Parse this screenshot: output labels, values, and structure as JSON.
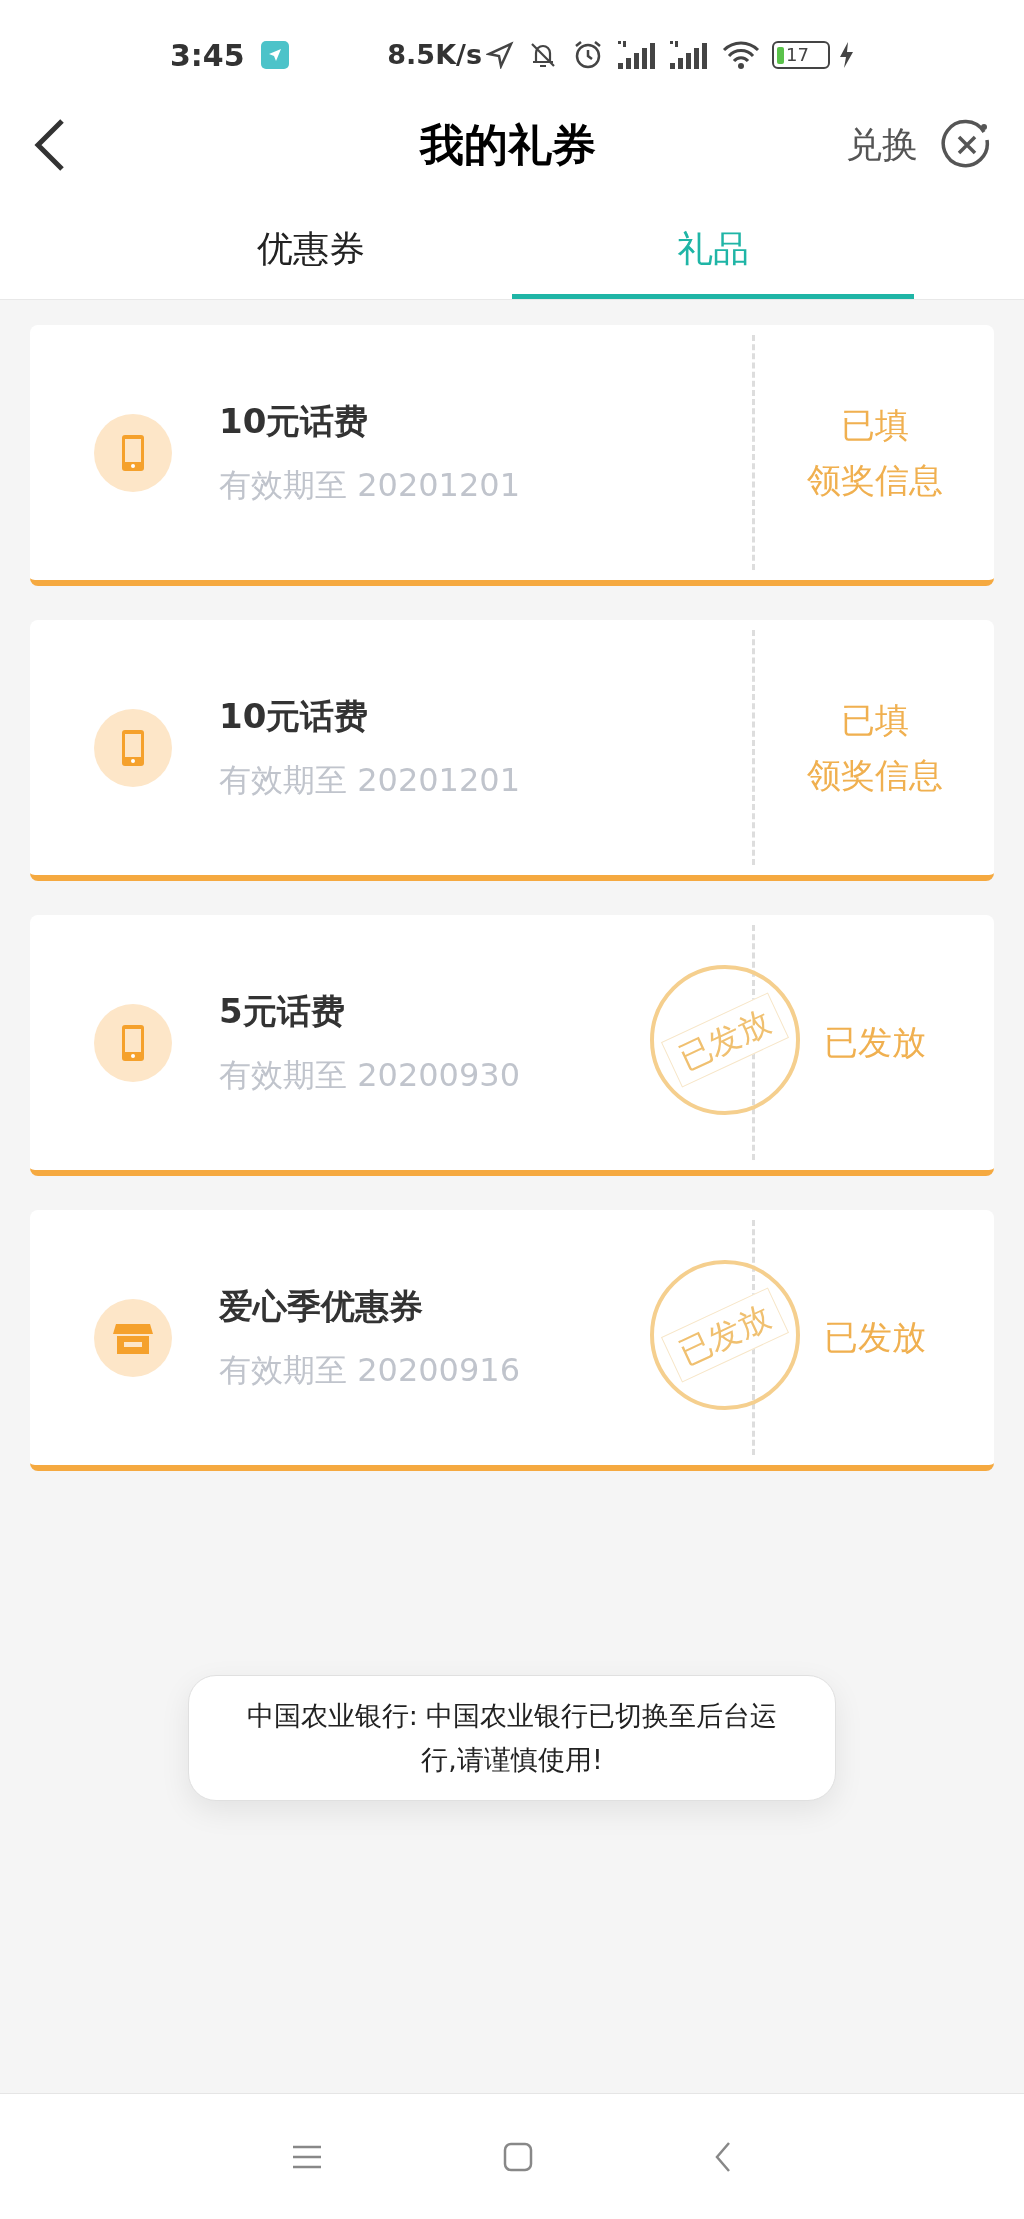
{
  "status_bar": {
    "time": "3:45",
    "speed": "8.5K/s",
    "battery": "17"
  },
  "header": {
    "title": "我的礼券",
    "action": "兑换"
  },
  "tabs": [
    {
      "label": "优惠券",
      "selected": false
    },
    {
      "label": "礼品",
      "selected": true
    }
  ],
  "cards": [
    {
      "kind": "phone",
      "title": "10元话费",
      "validity": "有效期至 20201201",
      "status": [
        "已填",
        "领奖信息"
      ],
      "stamped": false
    },
    {
      "kind": "phone",
      "title": "10元话费",
      "validity": "有效期至 20201201",
      "status": [
        "已填",
        "领奖信息"
      ],
      "stamped": false
    },
    {
      "kind": "phone",
      "title": "5元话费",
      "validity": "有效期至 20200930",
      "status": [
        "已发放"
      ],
      "stamped": true,
      "stamp_text": "已发放"
    },
    {
      "kind": "shop",
      "title": "爱心季优惠券",
      "validity": "有效期至 20200916",
      "status": [
        "已发放"
      ],
      "stamped": true,
      "stamp_text": "已发放"
    }
  ],
  "toast": {
    "text": "中国农业银行: 中国农业银行已切换至后台运行,请谨慎使用!"
  }
}
